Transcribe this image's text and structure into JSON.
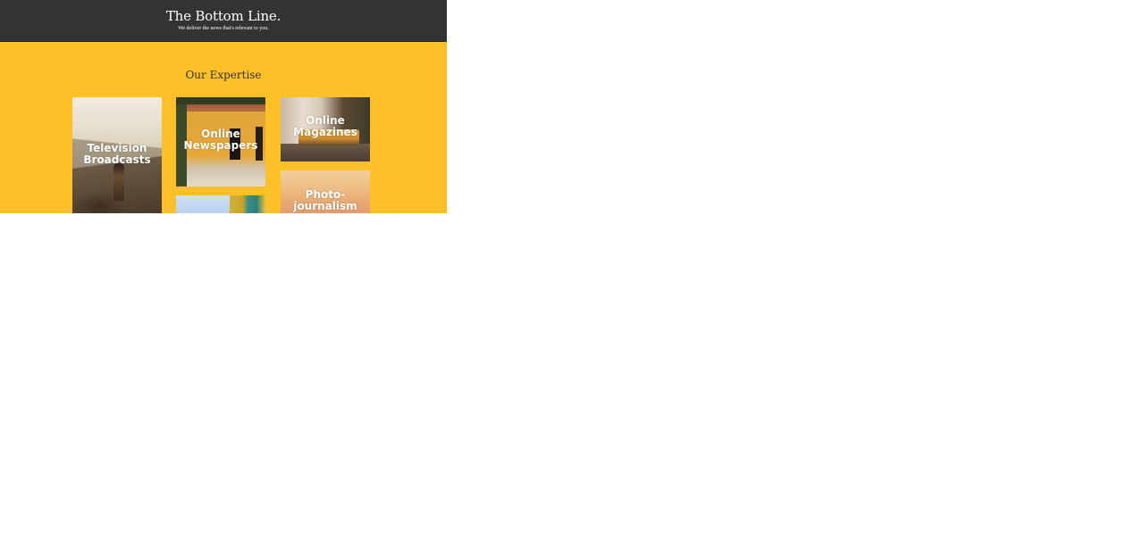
{
  "header": {
    "title": "The Bottom Line.",
    "tagline": "We deliver the news that's relevant to you."
  },
  "expertise": {
    "title": "Our Expertise",
    "cards": [
      {
        "label": "Television\nBroadcasts"
      },
      {
        "label": "Online\nNewspapers"
      },
      {
        "label": "Online\nMagazines"
      },
      {
        "label": "Photo-\njournalism"
      }
    ]
  },
  "colors": {
    "header_bg": "#333333",
    "page_bg": "#fdc029",
    "heading_text": "#333333",
    "card_text": "#ffffff"
  }
}
